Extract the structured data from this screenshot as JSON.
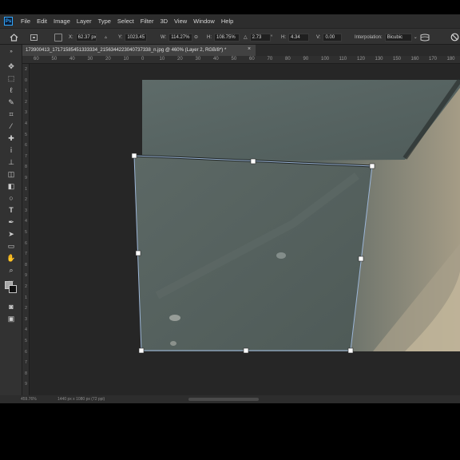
{
  "menu": {
    "logo": "Ps",
    "items": [
      "File",
      "Edit",
      "Image",
      "Layer",
      "Type",
      "Select",
      "Filter",
      "3D",
      "View",
      "Window",
      "Help"
    ]
  },
  "options": {
    "x_label": "X:",
    "x_value": "62.37 px",
    "y_label": "Y:",
    "y_value": "1023.45 p",
    "w_label": "W:",
    "w_value": "114.27%",
    "h_label": "H:",
    "h_value": "108.75%",
    "angle_value": "2.73",
    "hskew_label": "H:",
    "hskew_value": "4.34",
    "vskew_label": "V:",
    "vskew_value": "0.00",
    "interpolation_label": "Interpolation:",
    "interpolation_value": "Bicubic"
  },
  "document": {
    "tab_title": "173900413_17171585451333334_2156344223040737338_n.jpg @ 460% (Layer 2, RGB/8*) *",
    "close_glyph": "×"
  },
  "rulers": {
    "top_ticks": [
      "60",
      "50",
      "40",
      "30",
      "20",
      "10",
      "0",
      "10",
      "20",
      "30",
      "40",
      "50",
      "60",
      "70",
      "80",
      "90",
      "100",
      "110",
      "120",
      "130",
      "150",
      "160",
      "170",
      "180"
    ],
    "left_ticks": [
      "2",
      "0",
      "1",
      "2",
      "3",
      "4",
      "5",
      "6",
      "7",
      "8",
      "9",
      "1",
      "2",
      "3",
      "4",
      "5",
      "6",
      "7",
      "8",
      "9",
      "2",
      "1",
      "2",
      "3",
      "4",
      "5",
      "6",
      "7",
      "8",
      "9"
    ]
  },
  "status": {
    "zoom": "459.76%",
    "info": "1440 px x 1080 px (72 ppi)"
  },
  "colors": {
    "foreground": "#a8a8a8",
    "background": "#111111",
    "accent": "#31a8ff"
  }
}
